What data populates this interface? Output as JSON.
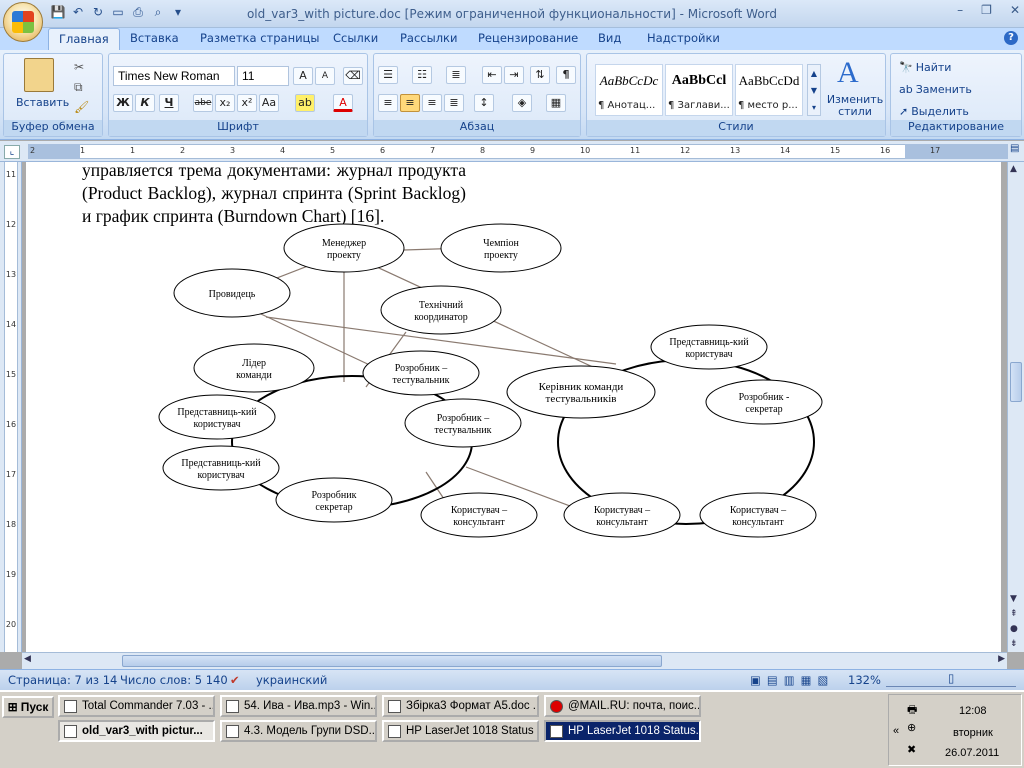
{
  "window": {
    "title": "old_var3_with picture.doc [Режим ограниченной функциональности] - Microsoft Word",
    "controls": [
      "–",
      "❐",
      "✕"
    ]
  },
  "qat": [
    "save-icon",
    "undo-icon",
    "redo-icon",
    "new-icon",
    "print-icon",
    "preview-icon"
  ],
  "tabs": [
    "Главная",
    "Вставка",
    "Разметка страницы",
    "Ссылки",
    "Рассылки",
    "Рецензирование",
    "Вид",
    "Надстройки"
  ],
  "ribbon": {
    "clipboard": {
      "label": "Буфер обмена",
      "paste": "Вставить"
    },
    "font": {
      "label": "Шрифт",
      "family": "Times New Roman",
      "size": "11",
      "bold": "Ж",
      "italic": "К",
      "underline": "Ч",
      "strike": "abe",
      "sub": "x₂",
      "sup": "x²",
      "case": "Aa",
      "grow": "A",
      "shrink": "A"
    },
    "paragraph": {
      "label": "Абзац",
      "pilcrow": "¶"
    },
    "styles": {
      "label": "Стили",
      "items": [
        {
          "sample": "AaBbCcDc",
          "name": "¶ Анотац..."
        },
        {
          "sample": "AaBbCcl",
          "name": "¶ Заглави..."
        },
        {
          "sample": "AaBbCcDd",
          "name": "¶ место р..."
        }
      ],
      "change": "Изменить стили"
    },
    "editing": {
      "label": "Редактирование",
      "find": "Найти",
      "replace": "Заменить",
      "select": "Выделить"
    }
  },
  "ruler": {
    "h": [
      "2",
      "1",
      "1",
      "2",
      "3",
      "4",
      "5",
      "6",
      "7",
      "8",
      "9",
      "10",
      "11",
      "12",
      "13",
      "14",
      "15",
      "16",
      "17"
    ],
    "v": [
      "11",
      "12",
      "13",
      "14",
      "15",
      "16",
      "17",
      "18",
      "19",
      "20"
    ]
  },
  "document": {
    "text": "управляется трема документами: журнал продукта (Product Backlog), журнал спринта (Sprint Backlog) и график спринта (Burndown Chart) [16]."
  },
  "diagram": {
    "nodes": [
      {
        "id": "manager",
        "text": "Менеджер проекту"
      },
      {
        "id": "champion",
        "text": "Чемпіон проекту"
      },
      {
        "id": "leader",
        "text": "Провидець"
      },
      {
        "id": "techcoord",
        "text": "Технічний координатор"
      },
      {
        "id": "teamlead",
        "text": "Лідер команди"
      },
      {
        "id": "dev1",
        "text": "Розробник – тестувальник"
      },
      {
        "id": "rep1",
        "text": "Представниць-кий користувач"
      },
      {
        "id": "dev2",
        "text": "Розробник – тестувальник"
      },
      {
        "id": "rep2",
        "text": "Представниць-кий користувач"
      },
      {
        "id": "devsec1",
        "text": "Розробник секретар"
      },
      {
        "id": "cons1",
        "text": "Користувач – консультант"
      },
      {
        "id": "testlead",
        "text": "Керівник команди тестувальників"
      },
      {
        "id": "rep3",
        "text": "Представниць-кий користувач"
      },
      {
        "id": "devsec2",
        "text": "Розробник - секретар"
      },
      {
        "id": "cons2",
        "text": "Користувач – консультант"
      },
      {
        "id": "cons3",
        "text": "Користувач – консультант"
      }
    ]
  },
  "status": {
    "page": "Страница: 7 из 14",
    "words": "Число слов: 5 140",
    "lang": "украинский",
    "zoom": "132%"
  },
  "taskbar": {
    "start": "Пуск",
    "row1": [
      "Total Commander 7.03 - ...",
      "54. Ива - Ива.mp3 - Win...",
      "Збірка3 Формат А5.doc ...",
      "@MAIL.RU: почта, поис..."
    ],
    "row2": [
      "old_var3_with pictur...",
      "4.3. Модель Групи DSD...",
      "HP LaserJet 1018 Status ...",
      "HP LaserJet 1018 Status..."
    ],
    "clock": {
      "time": "12:08",
      "day": "вторник",
      "date": "26.07.2011"
    }
  }
}
